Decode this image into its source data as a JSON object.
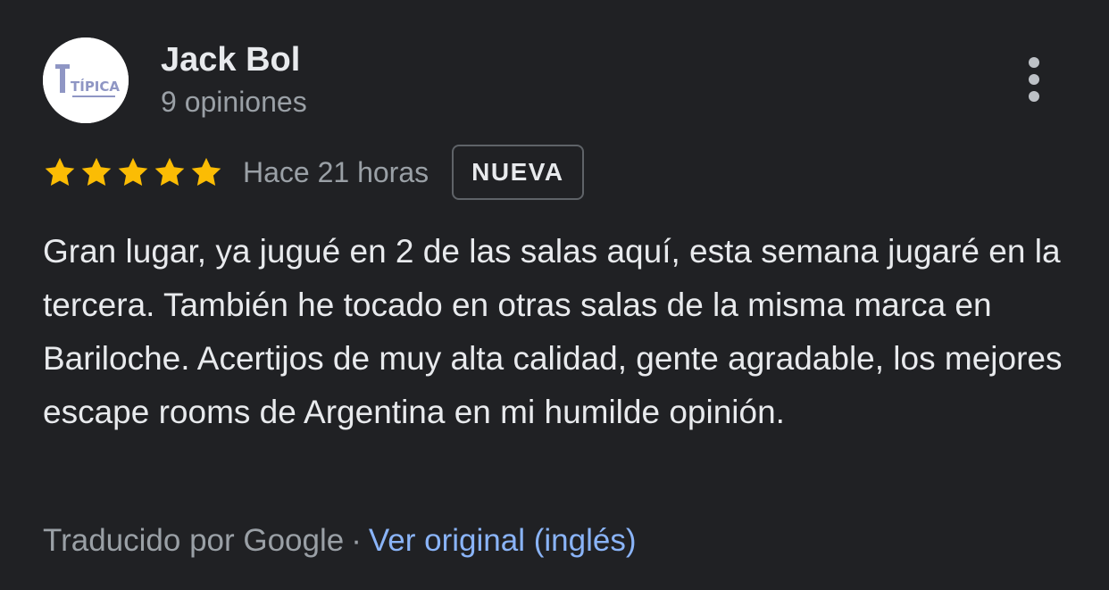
{
  "review": {
    "author": {
      "name": "Jack Bol",
      "reviews_count": "9 opiniones",
      "avatar_text": "TÍPICA",
      "avatar_icon": "tipica-logo-icon"
    },
    "more_menu_icon": "more-vert-icon",
    "rating": {
      "stars": 5,
      "max": 5,
      "star_color": "#fbbc04"
    },
    "time_ago": "Hace 21 horas",
    "badge": "NUEVA",
    "text": "Gran lugar, ya jugué en 2 de las salas aquí, esta semana jugaré en la tercera. También he tocado en otras salas de la misma marca en Bariloche. Acertijos de muy alta calidad, gente agradable, los mejores escape rooms de Argentina en mi humilde opinión.",
    "translation": {
      "note": "Traducido por Google",
      "separator": "·",
      "link": "Ver original (inglés)",
      "link_color": "#8ab4f8"
    }
  }
}
